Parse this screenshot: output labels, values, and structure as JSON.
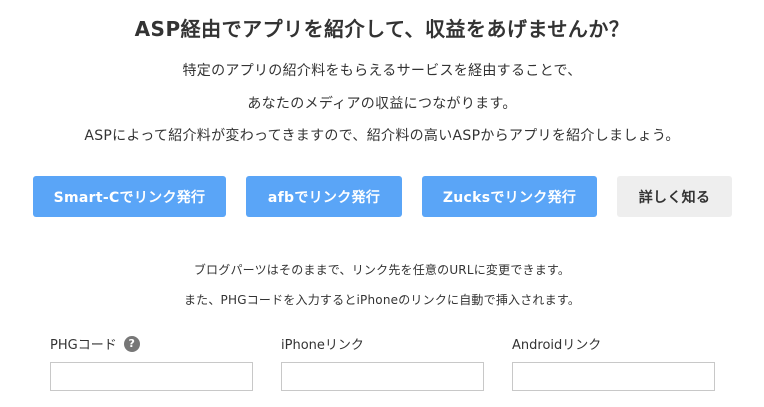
{
  "heading": "ASP経由でアプリを紹介して、収益をあげませんか？",
  "description": [
    "特定のアプリの紹介料をもらえるサービスを経由することで、",
    "あなたのメディアの収益につながります。",
    "ASPによって紹介料が変わってきますので、紹介料の高いASPからアプリを紹介しましょう。"
  ],
  "buttons": {
    "smartc": "Smart-Cでリンク発行",
    "afb": "afbでリンク発行",
    "zucks": "Zucksでリンク発行",
    "learn_more": "詳しく知る"
  },
  "notes": [
    "ブログパーツはそのままで、リンク先を任意のURLに変更できます。",
    "また、PHGコードを入力するとiPhoneのリンクに自動で挿入されます。"
  ],
  "fields": {
    "phg_label": "PHGコード",
    "phg_help": "?",
    "iphone_label": "iPhoneリンク",
    "android_label": "Androidリンク",
    "phg_value": "",
    "iphone_value": "",
    "android_value": ""
  },
  "colors": {
    "accent": "#5aa5f7",
    "secondary_button": "#eeeeee",
    "text": "#333333"
  }
}
